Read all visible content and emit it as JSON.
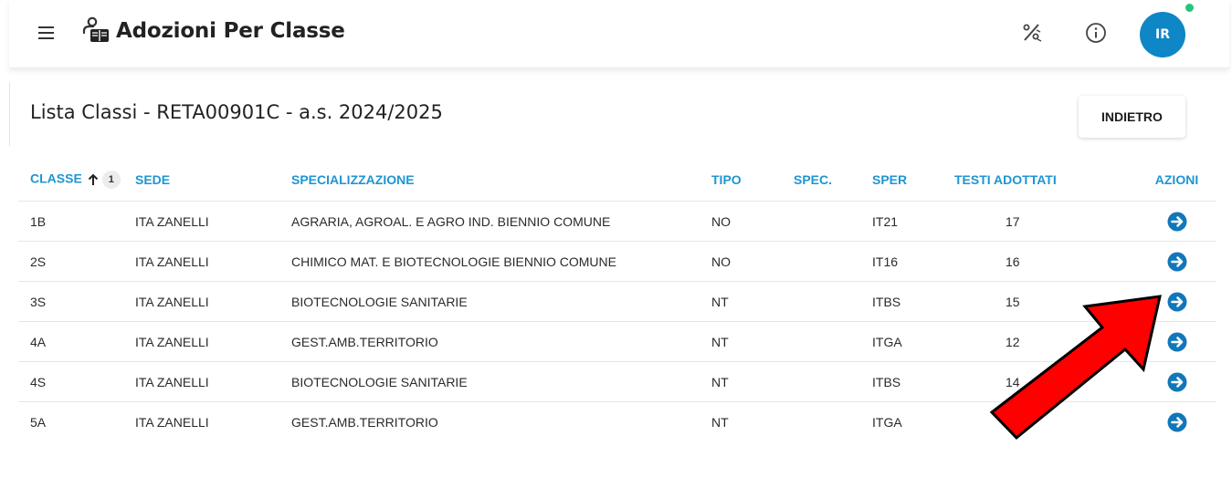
{
  "header": {
    "title": "Adozioni Per Classe",
    "menu_icon": "hamburger-menu-icon",
    "logo_icon": "teacher-book-icon",
    "actions": [
      {
        "icon": "percent-tool-icon"
      },
      {
        "icon": "info-icon"
      }
    ],
    "avatar_initials": "IR",
    "accent_color": "#0f86c5",
    "status_color": "#24c47a"
  },
  "page": {
    "title": "Lista Classi - RETA00901C - a.s. 2024/2025",
    "back_button": "INDIETRO"
  },
  "table": {
    "columns": {
      "classe": "CLASSE",
      "sede": "SEDE",
      "specializzazione": "SPECIALIZZAZIONE",
      "tipo": "TIPO",
      "spec": "SPEC.",
      "sper": "SPER",
      "testi": "TESTI ADOTTATI",
      "azioni": "AZIONI"
    },
    "sort_badge": "1",
    "header_color": "#1f95d1",
    "rows": [
      {
        "classe": "1B",
        "sede": "ITA ZANELLI",
        "specializzazione": "AGRARIA, AGROAL. E AGRO IND. BIENNIO COMUNE",
        "tipo": "NO",
        "spec": "",
        "sper": "IT21",
        "testi": "17"
      },
      {
        "classe": "2S",
        "sede": "ITA ZANELLI",
        "specializzazione": "CHIMICO MAT. E BIOTECNOLOGIE BIENNIO COMUNE",
        "tipo": "NO",
        "spec": "",
        "sper": "IT16",
        "testi": "16"
      },
      {
        "classe": "3S",
        "sede": "ITA ZANELLI",
        "specializzazione": "BIOTECNOLOGIE SANITARIE",
        "tipo": "NT",
        "spec": "",
        "sper": "ITBS",
        "testi": "15"
      },
      {
        "classe": "4A",
        "sede": "ITA ZANELLI",
        "specializzazione": "GEST.AMB.TERRITORIO",
        "tipo": "NT",
        "spec": "",
        "sper": "ITGA",
        "testi": "12"
      },
      {
        "classe": "4S",
        "sede": "ITA ZANELLI",
        "specializzazione": "BIOTECNOLOGIE SANITARIE",
        "tipo": "NT",
        "spec": "",
        "sper": "ITBS",
        "testi": "14"
      },
      {
        "classe": "5A",
        "sede": "ITA ZANELLI",
        "specializzazione": "GEST.AMB.TERRITORIO",
        "tipo": "NT",
        "spec": "",
        "sper": "ITGA",
        "testi": ""
      }
    ],
    "row_action_icon": "arrow-right-circle-icon"
  },
  "annotation": {
    "icon": "red-pointer-arrow-icon",
    "color": "#ff0000"
  }
}
